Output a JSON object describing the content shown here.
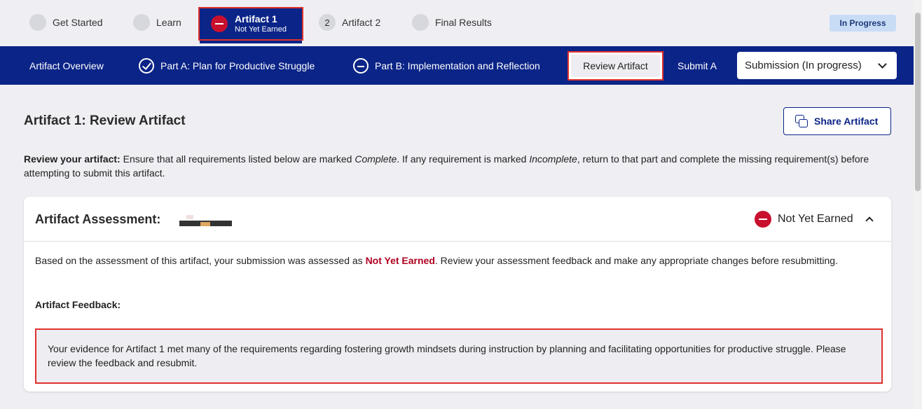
{
  "progress": {
    "steps": [
      {
        "label": "Get Started"
      },
      {
        "label": "Learn"
      },
      {
        "label": "Artifact 1",
        "sub": "Not Yet Earned",
        "active": true
      },
      {
        "label": "Artifact 2",
        "number": "2"
      },
      {
        "label": "Final Results"
      }
    ],
    "status": "In Progress"
  },
  "nav": {
    "overview": "Artifact Overview",
    "part_a": "Part A: Plan for Productive Struggle",
    "part_b": "Part B: Implementation and Reflection",
    "review": "Review Artifact",
    "submit": "Submit A",
    "submission_select": "Submission (In progress)"
  },
  "page": {
    "title": "Artifact 1: Review Artifact",
    "share": "Share Artifact",
    "instructions_bold": "Review your artifact:",
    "instructions_1": " Ensure that all requirements listed below are marked ",
    "complete": "Complete",
    "instructions_2": ". If any requirement is marked ",
    "incomplete": "Incomplete",
    "instructions_3": ", return to that part and complete the missing requirement(s) before attempting to submit this artifact."
  },
  "assessment": {
    "title": "Artifact Assessment:",
    "status": "Not Yet Earned",
    "summary_1": "Based on the assessment of this artifact, your submission was assessed as ",
    "summary_status": "Not Yet Earned",
    "summary_2": ". Review your assessment feedback and make any appropriate changes before resubmitting.",
    "feedback_label": "Artifact Feedback:",
    "feedback_text": "Your evidence for Artifact 1 met many of the requirements regarding fostering growth mindsets during instruction by planning and facilitating opportunities for productive struggle.  Please review the feedback and resubmit."
  },
  "colors": {
    "navy": "#0b2487",
    "red": "#c8102e",
    "highlight": "#e0312d"
  }
}
